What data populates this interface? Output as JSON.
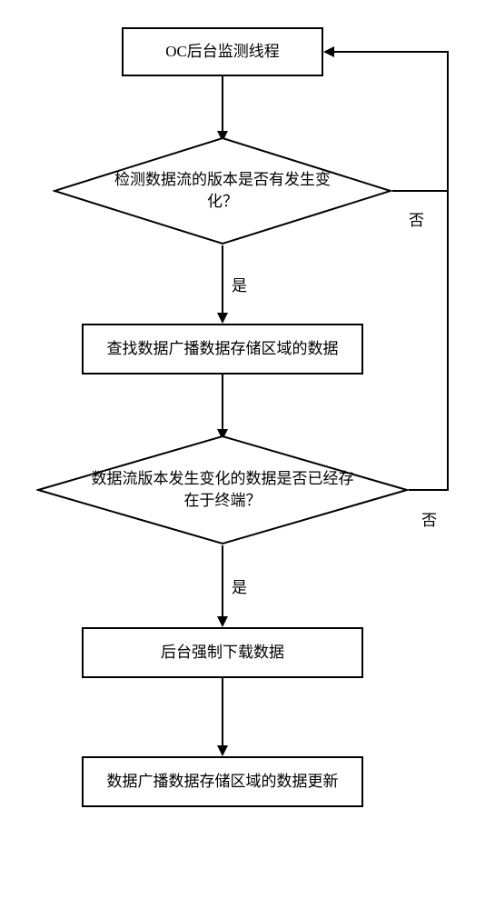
{
  "nodes": {
    "n1": "OC后台监测线程",
    "n2": "检测数据流的版本是否有发生变\n化？",
    "n3": "查找数据广播数据存储区域的数据",
    "n4": "数据流版本发生变化的数据是否已经存\n在于终端？",
    "n5": "后台强制下载数据",
    "n6": "数据广播数据存储区域的数据更新"
  },
  "labels": {
    "yes": "是",
    "no": "否"
  }
}
